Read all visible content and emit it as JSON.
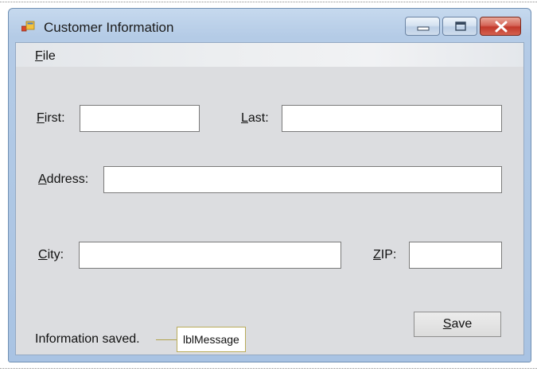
{
  "window": {
    "title": "Customer Information"
  },
  "menu": {
    "file_first": "F",
    "file_rest": "ile"
  },
  "form": {
    "first": {
      "accel": "F",
      "rest": "irst:",
      "value": ""
    },
    "last": {
      "accel": "L",
      "rest": "ast:",
      "value": ""
    },
    "address": {
      "accel": "A",
      "rest": "ddress:",
      "value": ""
    },
    "city": {
      "accel": "C",
      "rest": "ity:",
      "value": ""
    },
    "zip": {
      "accel": "Z",
      "rest": "IP:",
      "value": ""
    }
  },
  "save_button": {
    "accel": "S",
    "rest": "ave"
  },
  "status": {
    "message": "Information saved.",
    "callout": "lblMessage"
  },
  "colors": {
    "frame": "#a9c3e3",
    "client": "#dcdde0",
    "close": "#c2392b"
  },
  "icons": [
    "app-form-icon",
    "minimize-icon",
    "maximize-icon",
    "close-icon"
  ]
}
